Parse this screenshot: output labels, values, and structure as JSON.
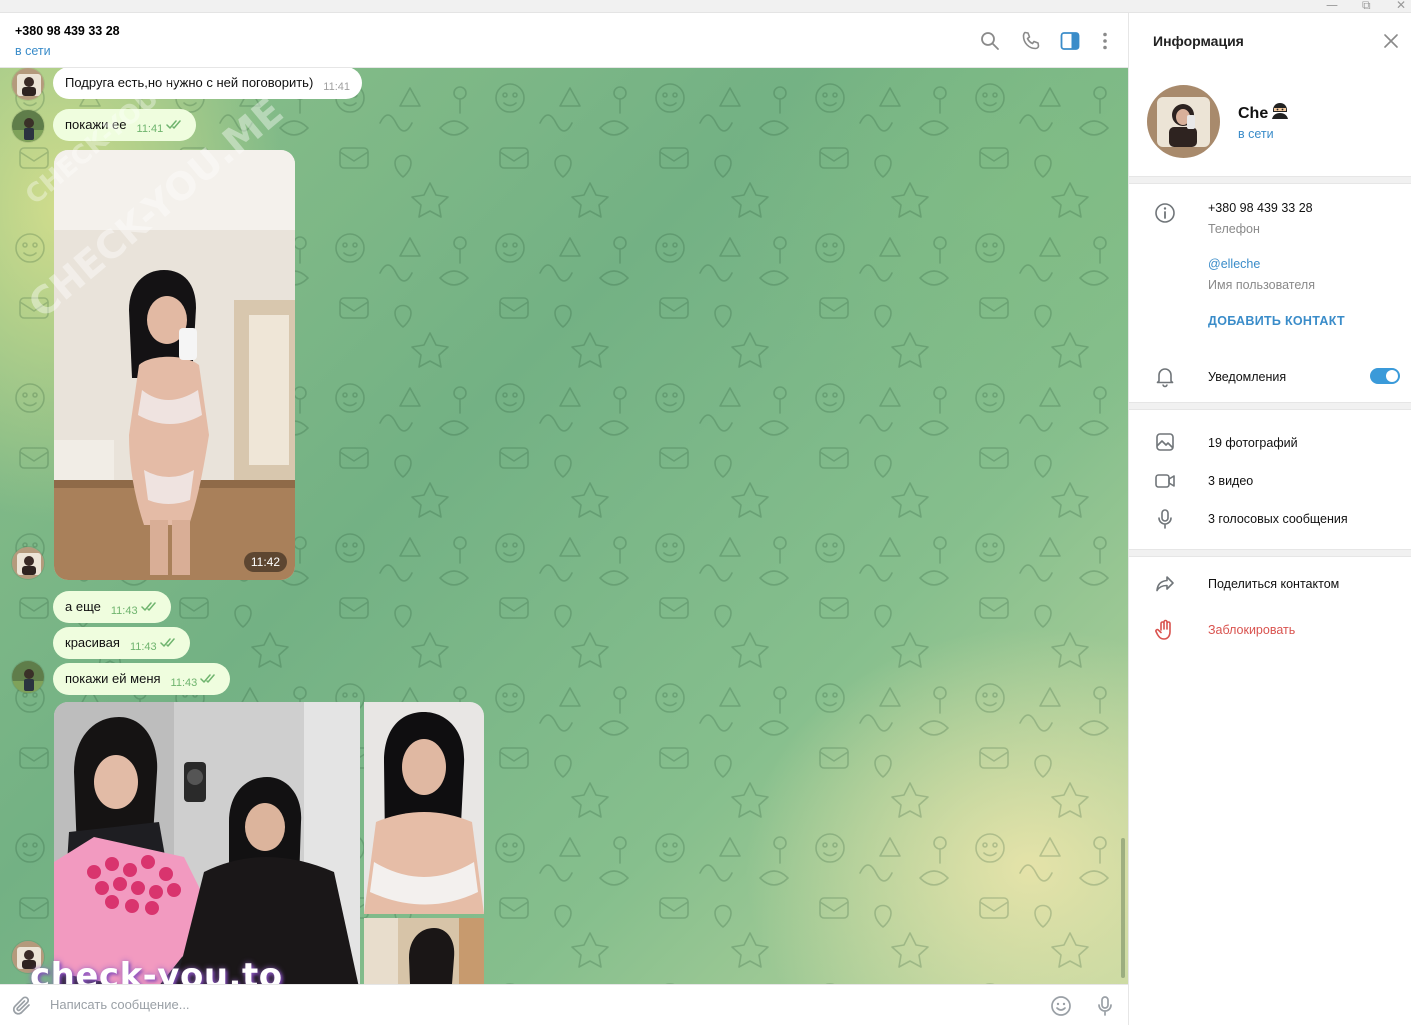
{
  "window": {
    "minimize_glyph": "—",
    "maximize_glyph": "⧉",
    "close_glyph": "✕"
  },
  "chat": {
    "title": "+380 98 439 33 28",
    "status": "в сети",
    "header_icons": [
      "search-icon",
      "phone-icon",
      "sidebar-toggle-icon",
      "more-vertical-icon"
    ],
    "messages": [
      {
        "direction": "in",
        "text": "Подруга есть,но нужно с ней поговорить)",
        "time": "11:41"
      },
      {
        "direction": "out",
        "text": "покажи ее",
        "time": "11:41",
        "read": true
      },
      {
        "direction": "in",
        "type": "photo",
        "time": "11:42"
      },
      {
        "direction": "out",
        "text": "а еще",
        "time": "11:43",
        "read": true
      },
      {
        "direction": "out",
        "text": "красивая",
        "time": "11:43",
        "read": true
      },
      {
        "direction": "out",
        "text": "покажи ей меня",
        "time": "11:43",
        "read": true
      },
      {
        "direction": "in",
        "type": "album",
        "photos": 3
      }
    ],
    "composer": {
      "placeholder": "Написать сообщение...",
      "icons": [
        "paperclip-icon",
        "emoji-icon",
        "microphone-icon"
      ]
    }
  },
  "watermarks": {
    "diagonal_main": "CHECK-YOU.ME",
    "diagonal_small": "CHECK-YOU.ME",
    "brand": "check-you.to"
  },
  "info_panel": {
    "title": "Информация",
    "name": "Che",
    "status": "в сети",
    "phone": {
      "value": "+380 98 439 33 28",
      "label": "Телефон"
    },
    "username": {
      "value": "@elleche",
      "label": "Имя пользователя"
    },
    "add_contact": "ДОБАВИТЬ КОНТАКТ",
    "notifications": {
      "label": "Уведомления",
      "enabled": true
    },
    "media": [
      {
        "icon": "image-icon",
        "label": "19 фотографий"
      },
      {
        "icon": "video-icon",
        "label": "3 видео"
      },
      {
        "icon": "microphone-icon",
        "label": "3 голосовых сообщения"
      }
    ],
    "share_contact": "Поделиться контактом",
    "block": "Заблокировать"
  },
  "colors": {
    "accent": "#3a8cc9",
    "outgoing_bubble": "#effdde",
    "incoming_bubble": "#ffffff",
    "danger": "#d9534f",
    "read_ticks": "#6fb46e"
  }
}
